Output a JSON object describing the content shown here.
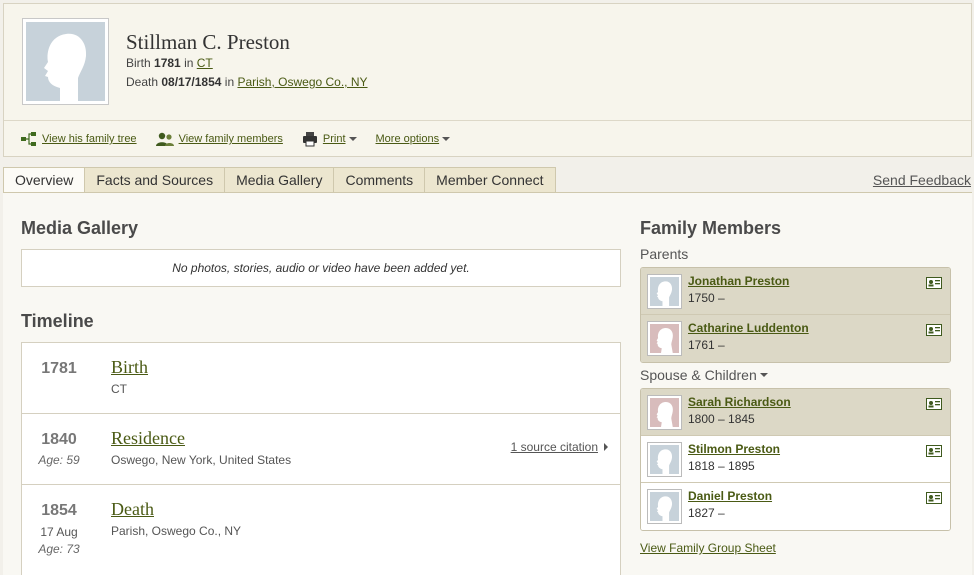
{
  "person": {
    "name": "Stillman C. Preston",
    "birth_label": "Birth",
    "birth_year": "1781",
    "birth_in": "in",
    "birth_place": "CT",
    "death_label": "Death",
    "death_date": "08/17/1854",
    "death_in": "in",
    "death_place": "Parish, Oswego Co., NY"
  },
  "actions": {
    "family_tree": "View his family tree",
    "family_members": "View family members",
    "print": "Print",
    "more_options": "More options"
  },
  "tabs": [
    {
      "label": "Overview"
    },
    {
      "label": "Facts and Sources"
    },
    {
      "label": "Media Gallery"
    },
    {
      "label": "Comments"
    },
    {
      "label": "Member Connect"
    }
  ],
  "send_feedback": "Send Feedback",
  "media_gallery": {
    "title": "Media Gallery",
    "empty_message": "No photos, stories, audio or video have been added yet."
  },
  "timeline": {
    "title": "Timeline",
    "events": [
      {
        "year": "1781",
        "date": "",
        "age": "",
        "title": "Birth",
        "place": "CT",
        "citation": ""
      },
      {
        "year": "1840",
        "date": "",
        "age": "Age: 59",
        "title": "Residence",
        "place": "Oswego, New York, United States",
        "citation": "1 source citation"
      },
      {
        "year": "1854",
        "date": "17 Aug",
        "age": "Age: 73",
        "title": "Death",
        "place": "Parish, Oswego Co., NY",
        "citation": ""
      }
    ]
  },
  "family": {
    "title": "Family Members",
    "parents_label": "Parents",
    "spouse_label": "Spouse & Children",
    "parents": [
      {
        "name": "Jonathan Preston",
        "dates": "1750 –"
      },
      {
        "name": "Catharine Luddenton",
        "dates": "1761 –"
      }
    ],
    "spouse_children": [
      {
        "name": "Sarah Richardson",
        "dates": "1800 – 1845"
      },
      {
        "name": "Stilmon Preston",
        "dates": "1818 – 1895"
      },
      {
        "name": "Daniel Preston",
        "dates": "1827 –"
      }
    ],
    "group_sheet": "View Family Group Sheet"
  },
  "icons": {
    "tree": "family-tree-icon",
    "members": "people-icon",
    "print": "printer-icon",
    "card": "profile-card-icon",
    "silhouette": "silhouette-icon"
  },
  "colors": {
    "link": "#4a5a14",
    "tab_bg": "#ece6cf",
    "shaded_row": "#dcd8c6",
    "male_placeholder": "#c7d2da",
    "female_placeholder": "#d8bcbc"
  }
}
